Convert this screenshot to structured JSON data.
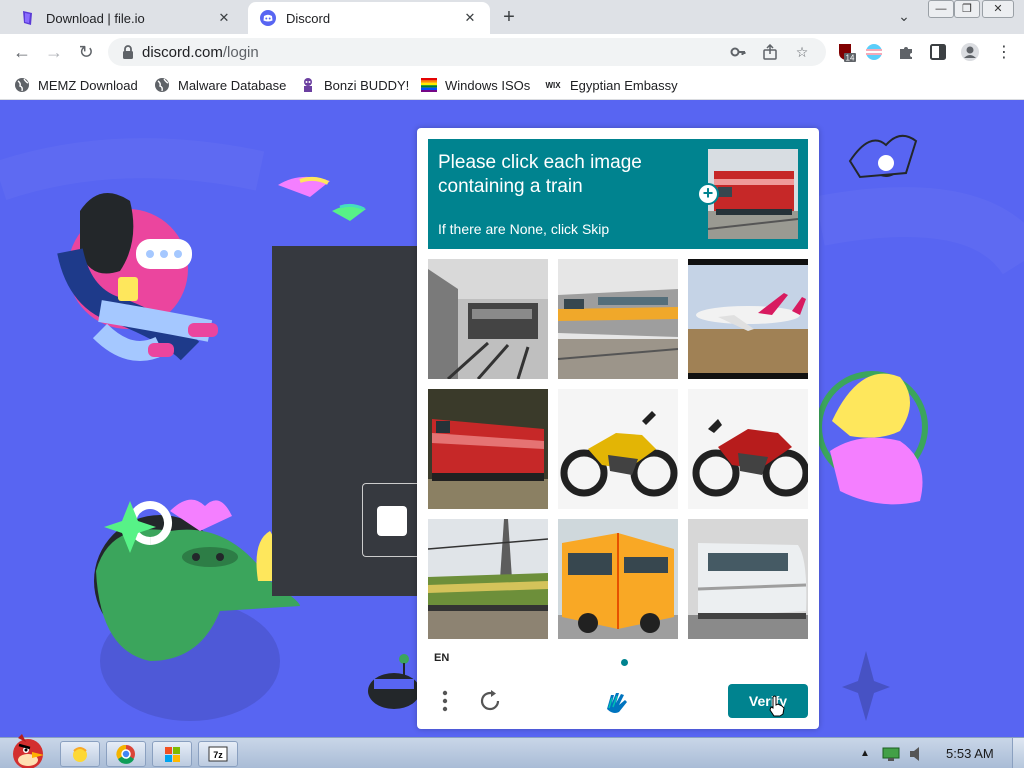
{
  "browser": {
    "tabs": [
      {
        "title": "Download | file.io",
        "close": "✕"
      },
      {
        "title": "Discord",
        "close": "✕"
      }
    ],
    "new_tab": "+",
    "url_host": "discord.com",
    "url_path": "/login",
    "extension_badge": "14",
    "bookmarks": [
      {
        "label": "MEMZ Download",
        "icon": "globe-icon"
      },
      {
        "label": "Malware Database",
        "icon": "globe-icon"
      },
      {
        "label": "Bonzi BUDDY!",
        "icon": "bonzi-icon"
      },
      {
        "label": "Windows ISOs",
        "icon": "rainbow-flag-icon"
      },
      {
        "label": "Egyptian Embassy",
        "icon": "wix-icon"
      }
    ],
    "wix_text": "WIX"
  },
  "captcha": {
    "prompt_line1": "Please click each image containing a train",
    "prompt_line2": "If there are None, click Skip",
    "language": "EN",
    "verify_label": "Verify",
    "images": [
      "train-station-grey",
      "train-yellow-passenger",
      "airplane",
      "train-red-locomotive",
      "motorcycle-yellow",
      "motorcycle-red",
      "train-green-overhead",
      "school-bus",
      "train-white-modern"
    ],
    "accent_color": "#00838f"
  },
  "taskbar": {
    "clock": "5:53 AM",
    "show_hidden": "▲"
  }
}
